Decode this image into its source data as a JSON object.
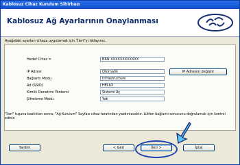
{
  "window": {
    "title": "Kablosuz Cihaz Kurulum Sihirbazı"
  },
  "header": {
    "title": "Kablosuz Ağ Ayarlarının Onaylanması"
  },
  "instruction": "Aşağıdaki ayarları cihaza uygulamak için \"İleri\"yi tıklayınız.",
  "fields": {
    "target_label": "Hedef Cihaz =",
    "target_value": "BRN XXXXXXXXXXXX",
    "ip_label": "IP Adresi",
    "ip_value": "Otomatik",
    "connection_label": "Bağlantı Modu",
    "connection_value": "Infrastructure",
    "ssid_label": "Ad (SSID)",
    "ssid_value": "HELLO",
    "auth_label": "Kimlik Denetimi Yöntemi",
    "auth_value": "Sistemi Aç",
    "encryption_label": "Şifreleme Modu",
    "encryption_value": "Yok"
  },
  "buttons": {
    "change_ip": "IP Adresini değiştir",
    "help": "Yardım",
    "back": "< Geri",
    "next": "İleri >",
    "cancel": "İptal"
  },
  "note": {
    "text": "\"İleri\" tuşuna bastıktan sonra, \"Ağ Kurulum\" Sayfası cihaz tarafından yazdırılacaktır. Lütfen bağlantı sonucunu doğrulamak için kontrol ediniz."
  }
}
